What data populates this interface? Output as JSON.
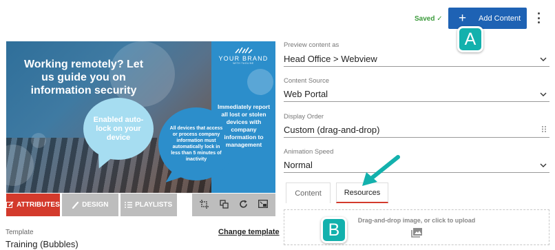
{
  "header": {
    "saved_text": "Saved ✓",
    "add_content_label": "Add Content",
    "plus_glyph": "+"
  },
  "callouts": {
    "a": "A",
    "b": "B"
  },
  "preview": {
    "headline": "Working remotely? Let us guide you on information security",
    "bubble_primary": "Enabled auto-lock on your device",
    "bubble_secondary": "All devices that access or process company information must automatically lock in less than 5 minutes of inactivity",
    "brand_name": "YOUR BRAND",
    "brand_tagline": "WITH TAGLINE",
    "side_text": "Immediately report all lost or stolen devices with company information to management"
  },
  "editor_tabs": [
    {
      "label": "ATTRIBUTES",
      "icon": "edit-icon",
      "active": true
    },
    {
      "label": "DESIGN",
      "icon": "brush-icon",
      "active": false
    },
    {
      "label": "PLAYLISTS",
      "icon": "list-icon",
      "active": false
    }
  ],
  "toolbar_icons": [
    "crop-icon",
    "layers-icon",
    "refresh-icon",
    "picture-in-picture-icon"
  ],
  "template": {
    "label": "Template",
    "value": "Training (Bubbles)",
    "change_link": "Change template"
  },
  "form": {
    "preview_as": {
      "label": "Preview content as",
      "value": "Head Office > Webview"
    },
    "content_source": {
      "label": "Content Source",
      "value": "Web Portal"
    },
    "display_order": {
      "label": "Display Order",
      "value": "Custom (drag-and-drop)"
    },
    "animation_speed": {
      "label": "Animation Speed",
      "value": "Normal"
    }
  },
  "sub_tabs": [
    {
      "label": "Content",
      "active": false
    },
    {
      "label": "Resources",
      "active": true
    }
  ],
  "dropzone": {
    "text": "Drag-and-drop image, or click to upload"
  },
  "colors": {
    "accent_blue": "#1e62b4",
    "accent_red": "#d33a2c",
    "callout_teal": "#13b1ad",
    "saved_green": "#3a9a3a"
  }
}
